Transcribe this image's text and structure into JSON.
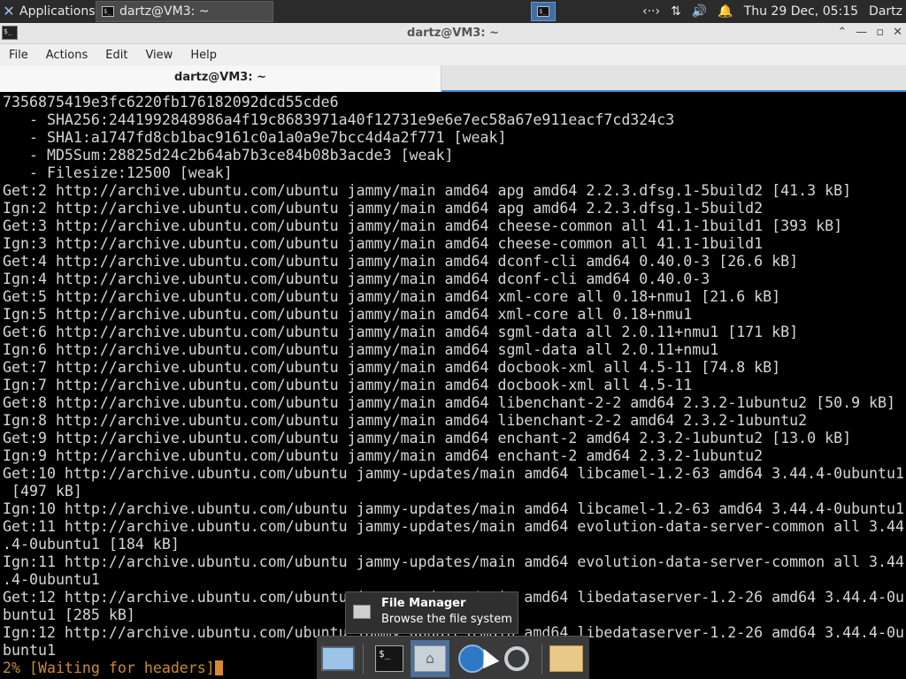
{
  "top_panel": {
    "applications_label": "Applications",
    "task_label": "dartz@VM3: ~",
    "clock": "Thu 29 Dec, 05:15",
    "user": "Dartz"
  },
  "window": {
    "title": "dartz@VM3: ~",
    "menu": [
      "File",
      "Actions",
      "Edit",
      "View",
      "Help"
    ],
    "tab_label": "dartz@VM3: ~"
  },
  "terminal": {
    "lines": [
      "7356875419e3fc6220fb176182092dcd55cde6",
      "   - SHA256:2441992848986a4f19c8683971a40f12731e9e6e7ec58a67e911eacf7cd324c3",
      "   - SHA1:a1747fd8cb1bac9161c0a1a0a9e7bcc4d4a2f771 [weak]",
      "   - MD5Sum:28825d24c2b64ab7b3ce84b08b3acde3 [weak]",
      "   - Filesize:12500 [weak]",
      "Get:2 http://archive.ubuntu.com/ubuntu jammy/main amd64 apg amd64 2.2.3.dfsg.1-5build2 [41.3 kB]",
      "Ign:2 http://archive.ubuntu.com/ubuntu jammy/main amd64 apg amd64 2.2.3.dfsg.1-5build2",
      "Get:3 http://archive.ubuntu.com/ubuntu jammy/main amd64 cheese-common all 41.1-1build1 [393 kB]",
      "Ign:3 http://archive.ubuntu.com/ubuntu jammy/main amd64 cheese-common all 41.1-1build1",
      "Get:4 http://archive.ubuntu.com/ubuntu jammy/main amd64 dconf-cli amd64 0.40.0-3 [26.6 kB]",
      "Ign:4 http://archive.ubuntu.com/ubuntu jammy/main amd64 dconf-cli amd64 0.40.0-3",
      "Get:5 http://archive.ubuntu.com/ubuntu jammy/main amd64 xml-core all 0.18+nmu1 [21.6 kB]",
      "Ign:5 http://archive.ubuntu.com/ubuntu jammy/main amd64 xml-core all 0.18+nmu1",
      "Get:6 http://archive.ubuntu.com/ubuntu jammy/main amd64 sgml-data all 2.0.11+nmu1 [171 kB]",
      "Ign:6 http://archive.ubuntu.com/ubuntu jammy/main amd64 sgml-data all 2.0.11+nmu1",
      "Get:7 http://archive.ubuntu.com/ubuntu jammy/main amd64 docbook-xml all 4.5-11 [74.8 kB]",
      "Ign:7 http://archive.ubuntu.com/ubuntu jammy/main amd64 docbook-xml all 4.5-11",
      "Get:8 http://archive.ubuntu.com/ubuntu jammy/main amd64 libenchant-2-2 amd64 2.3.2-1ubuntu2 [50.9 kB]",
      "Ign:8 http://archive.ubuntu.com/ubuntu jammy/main amd64 libenchant-2-2 amd64 2.3.2-1ubuntu2",
      "Get:9 http://archive.ubuntu.com/ubuntu jammy/main amd64 enchant-2 amd64 2.3.2-1ubuntu2 [13.0 kB]",
      "Ign:9 http://archive.ubuntu.com/ubuntu jammy/main amd64 enchant-2 amd64 2.3.2-1ubuntu2",
      "Get:10 http://archive.ubuntu.com/ubuntu jammy-updates/main amd64 libcamel-1.2-63 amd64 3.44.4-0ubuntu1",
      " [497 kB]",
      "Ign:10 http://archive.ubuntu.com/ubuntu jammy-updates/main amd64 libcamel-1.2-63 amd64 3.44.4-0ubuntu1",
      "Get:11 http://archive.ubuntu.com/ubuntu jammy-updates/main amd64 evolution-data-server-common all 3.44",
      ".4-0ubuntu1 [184 kB]",
      "Ign:11 http://archive.ubuntu.com/ubuntu jammy-updates/main amd64 evolution-data-server-common all 3.44",
      ".4-0ubuntu1",
      "Get:12 http://archive.ubuntu.com/ubuntu jammy-updates/main amd64 libedataserver-1.2-26 amd64 3.44.4-0u",
      "buntu1 [285 kB]",
      "Ign:12 http://archive.ubuntu.com/ubuntu jammy-updates/main amd64 libedataserver-1.2-26 amd64 3.44.4-0u",
      "buntu1"
    ],
    "progress_line": "2% [Waiting for headers]"
  },
  "tooltip": {
    "title": "File Manager",
    "subtitle": "Browse the file system"
  }
}
